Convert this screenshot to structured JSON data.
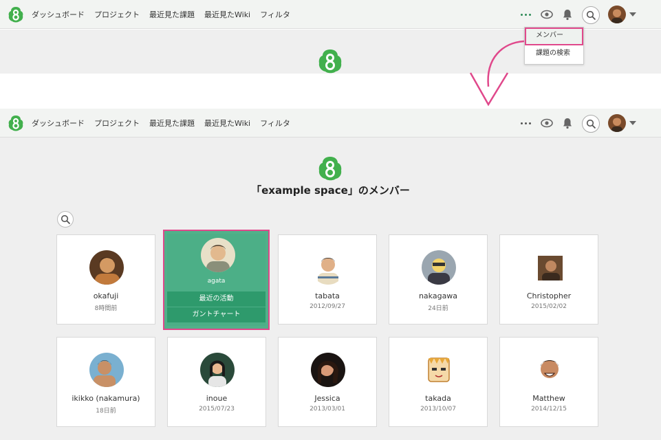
{
  "nav": {
    "links": [
      "ダッシュボード",
      "プロジェクト",
      "最近見た課題",
      "最近見たWiki",
      "フィルタ"
    ]
  },
  "dropdown": {
    "items": [
      "メンバー",
      "課題の検索"
    ]
  },
  "page": {
    "title": "「example space」のメンバー"
  },
  "members": [
    {
      "name": "okafuji",
      "sub": "8時間前"
    },
    {
      "name": "agata",
      "actions": [
        "最近の活動",
        "ガントチャート"
      ]
    },
    {
      "name": "tabata",
      "sub": "2012/09/27"
    },
    {
      "name": "nakagawa",
      "sub": "24日前"
    },
    {
      "name": "Christopher",
      "sub": "2015/02/02"
    },
    {
      "name": "ikikko (nakamura)",
      "sub": "18日前"
    },
    {
      "name": "inoue",
      "sub": "2015/07/23"
    },
    {
      "name": "Jessica",
      "sub": "2013/03/01"
    },
    {
      "name": "takada",
      "sub": "2013/10/07"
    },
    {
      "name": "Matthew",
      "sub": "2014/12/15"
    }
  ],
  "colors": {
    "brand": "#42b04d",
    "accent_green": "#4caf87",
    "highlight": "#e0488b"
  }
}
